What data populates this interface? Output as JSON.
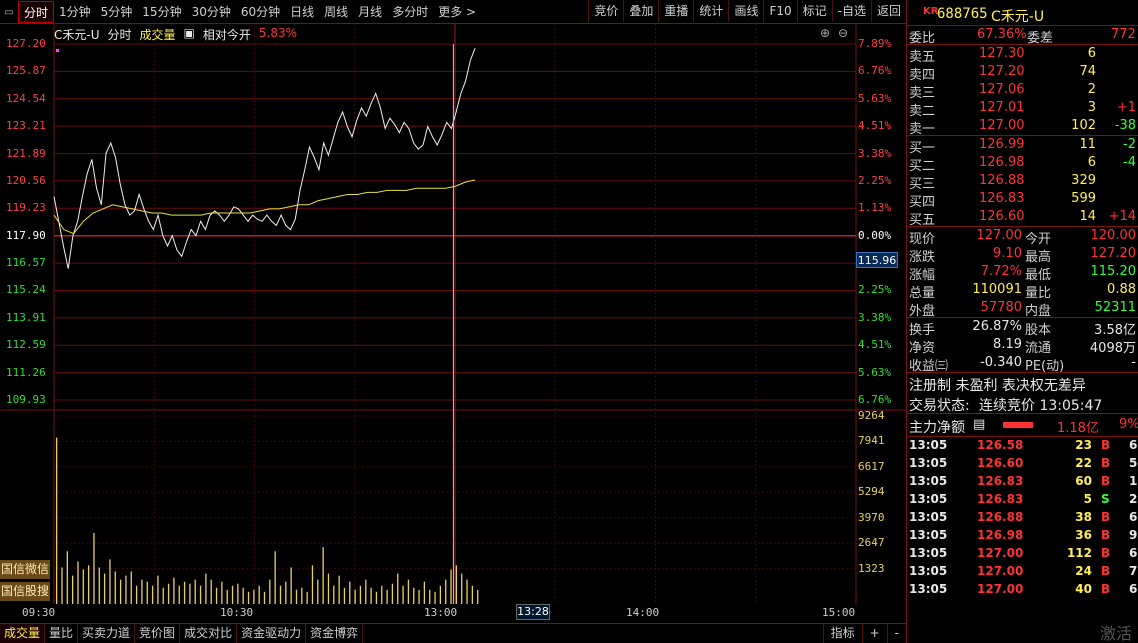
{
  "toolbar": {
    "periods": [
      "分时",
      "1分钟",
      "5分钟",
      "15分钟",
      "30分钟",
      "60分钟",
      "日线",
      "周线",
      "月线",
      "多分时",
      "更多 >"
    ],
    "active_period": "分时",
    "tools": [
      "竞价",
      "叠加",
      "重播",
      "统计",
      "画线",
      "F10",
      "标记",
      "-自选",
      "返回"
    ]
  },
  "chart": {
    "title": "C禾元-U",
    "mode": "分时",
    "indicator": "成交量",
    "relative_label": "相对今开",
    "relative_value": "5.83%",
    "price_ticks_left": [
      "127.20",
      "125.87",
      "124.54",
      "123.21",
      "121.89",
      "120.56",
      "119.23",
      "117.90",
      "116.57",
      "115.24",
      "113.91",
      "112.59",
      "111.26",
      "109.93"
    ],
    "pct_ticks_right": [
      "7.89%",
      "6.76%",
      "5.63%",
      "4.51%",
      "3.38%",
      "2.25%",
      "1.13%",
      "0.00%",
      "1.13%",
      "2.25%",
      "3.38%",
      "4.51%",
      "5.63%",
      "6.76%"
    ],
    "vol_ticks_right": [
      "9264",
      "7941",
      "6617",
      "5294",
      "3970",
      "2647",
      "1323"
    ],
    "time_ticks": [
      "09:30",
      "10:30",
      "13:00",
      "14:00",
      "15:00"
    ],
    "cursor_time": "13:28",
    "cursor_price": "115.96",
    "side_buttons": [
      "国信微信",
      "国信股搜"
    ]
  },
  "chart_data": {
    "type": "line",
    "title": "",
    "xlabel": "",
    "ylabel": "",
    "ylim": [
      109.93,
      127.2
    ],
    "x_session": [
      "09:30",
      "11:30/13:00",
      "15:00"
    ],
    "series": [
      {
        "name": "",
        "values": [
          119.8,
          118.6,
          117.4,
          116.3,
          117.9,
          118.6,
          119.8,
          120.9,
          121.6,
          120.2,
          119.4,
          121.9,
          122.4,
          121.7,
          120.4,
          119.4,
          118.9,
          119.1,
          119.9,
          119.2,
          118.6,
          118.2,
          118.9,
          117.9,
          117.4,
          117.9,
          117.2,
          116.9,
          117.6,
          118.2,
          117.9,
          118.6,
          118.2,
          118.9,
          119.1,
          118.9,
          118.6,
          118.9,
          119.3,
          119.2,
          118.9,
          118.6,
          118.9,
          118.7,
          118.6,
          118.9,
          118.6,
          118.4,
          118.9,
          118.4,
          118.2,
          118.7,
          120.1,
          121.1,
          122.2,
          121.7,
          121.1,
          122.4,
          121.8,
          122.6,
          123.4,
          123.9,
          123.2,
          122.7,
          123.5,
          124.1,
          123.7,
          124.3,
          124.8,
          124.1,
          123.1,
          123.6,
          123.3,
          122.9,
          123.4,
          123.1,
          122.4,
          122.1,
          122.3,
          123.2,
          122.7,
          122.3,
          122.8,
          123.4,
          123.1,
          123.9,
          124.8,
          125.4,
          126.4,
          127.0
        ]
      },
      {
        "name": "",
        "values": [
          118.9,
          118.2,
          118.0,
          118.6,
          119.0,
          119.2,
          119.4,
          119.3,
          119.2,
          119.1,
          119.0,
          119.0,
          118.9,
          118.9,
          118.9,
          118.9,
          119.0,
          119.0,
          119.0,
          119.0,
          119.0,
          119.1,
          119.2,
          119.2,
          119.3,
          119.4,
          119.4,
          119.6,
          119.7,
          119.8,
          119.9,
          119.9,
          120.0,
          120.0,
          120.1,
          120.1,
          120.1,
          120.2,
          120.2,
          120.2,
          120.2,
          120.3,
          120.5,
          120.6
        ]
      }
    ],
    "volume": [
      8200,
      1800,
      2600,
      1400,
      2100,
      1700,
      1900,
      3500,
      1800,
      1500,
      2200,
      1600,
      1200,
      1400,
      1600,
      900,
      1200,
      1100,
      900,
      1400,
      800,
      1000,
      1300,
      900,
      1100,
      1000,
      1200,
      900,
      1500,
      1200,
      800,
      1100,
      700,
      900,
      1000,
      800,
      600,
      700,
      900,
      600,
      1200,
      2600,
      900,
      1100,
      1800,
      700,
      800,
      600,
      1900,
      1200,
      2800,
      1500,
      900,
      1400,
      800,
      1100,
      700,
      900,
      1200,
      800,
      600,
      900,
      700,
      1000,
      1500,
      900,
      1200,
      800,
      700,
      1100,
      700,
      600,
      900,
      1200,
      1700,
      1900,
      1500,
      1200,
      900,
      700
    ]
  },
  "quote": {
    "code": "688765",
    "kr": "KR",
    "name": "C禾元-U",
    "weibi_label": "委比",
    "weibi": "67.36%",
    "weicha_label": "委差",
    "weicha": "772",
    "asks": [
      {
        "label": "卖五",
        "price": "127.30",
        "vol": "6",
        "chg": ""
      },
      {
        "label": "卖四",
        "price": "127.20",
        "vol": "74",
        "chg": ""
      },
      {
        "label": "卖三",
        "price": "127.06",
        "vol": "2",
        "chg": ""
      },
      {
        "label": "卖二",
        "price": "127.01",
        "vol": "3",
        "chg": "+1"
      },
      {
        "label": "卖一",
        "price": "127.00",
        "vol": "102",
        "chg": "-38"
      }
    ],
    "bids": [
      {
        "label": "买一",
        "price": "126.99",
        "vol": "11",
        "chg": "-2"
      },
      {
        "label": "买二",
        "price": "126.98",
        "vol": "6",
        "chg": "-4"
      },
      {
        "label": "买三",
        "price": "126.88",
        "vol": "329",
        "chg": ""
      },
      {
        "label": "买四",
        "price": "126.83",
        "vol": "599",
        "chg": ""
      },
      {
        "label": "买五",
        "price": "126.60",
        "vol": "14",
        "chg": "+14"
      }
    ],
    "stats": [
      {
        "l1": "现价",
        "v1": "127.00",
        "l2": "今开",
        "v2": "120.00"
      },
      {
        "l1": "涨跌",
        "v1": "9.10",
        "l2": "最高",
        "v2": "127.20"
      },
      {
        "l1": "涨幅",
        "v1": "7.72%",
        "l2": "最低",
        "v2": "115.20"
      },
      {
        "l1": "总量",
        "v1": "110091",
        "l2": "量比",
        "v2": "0.88"
      },
      {
        "l1": "外盘",
        "v1": "57780",
        "l2": "内盘",
        "v2": "52311"
      }
    ],
    "fund": [
      {
        "l1": "换手",
        "v1": "26.87%",
        "l2": "股本",
        "v2": "3.58亿"
      },
      {
        "l1": "净资",
        "v1": "8.19",
        "l2": "流通",
        "v2": "4098万"
      },
      {
        "l1": "收益㈢",
        "v1": "-0.340",
        "l2": "PE(动)",
        "v2": "-"
      }
    ],
    "tags": "注册制 未盈利 表决权无差异",
    "trade_status_label": "交易状态:",
    "trade_status": "连续竞价 13:05:47",
    "main_flow_label": "主力净额",
    "main_flow_value": "1.18亿",
    "main_flow_pct": "9%",
    "ticks": [
      {
        "t": "13:05",
        "p": "126.58",
        "v": "23",
        "d": "B",
        "n": "6"
      },
      {
        "t": "13:05",
        "p": "126.60",
        "v": "22",
        "d": "B",
        "n": "5"
      },
      {
        "t": "13:05",
        "p": "126.83",
        "v": "60",
        "d": "B",
        "n": "15"
      },
      {
        "t": "13:05",
        "p": "126.83",
        "v": "5",
        "d": "S",
        "n": "2"
      },
      {
        "t": "13:05",
        "p": "126.88",
        "v": "38",
        "d": "B",
        "n": "6"
      },
      {
        "t": "13:05",
        "p": "126.98",
        "v": "36",
        "d": "B",
        "n": "9"
      },
      {
        "t": "13:05",
        "p": "127.00",
        "v": "112",
        "d": "B",
        "n": "6"
      },
      {
        "t": "13:05",
        "p": "127.00",
        "v": "24",
        "d": "B",
        "n": "7"
      },
      {
        "t": "13:05",
        "p": "127.00",
        "v": "40",
        "d": "B",
        "n": "6"
      }
    ]
  },
  "bottom_tabs": [
    "成交量",
    "量比",
    "买卖力道",
    "竞价图",
    "成交对比",
    "资金驱动力",
    "资金博弈"
  ],
  "bottom_active": "成交量",
  "bottom_tools": [
    "指标",
    "+",
    "-"
  ],
  "watermark": "激活"
}
